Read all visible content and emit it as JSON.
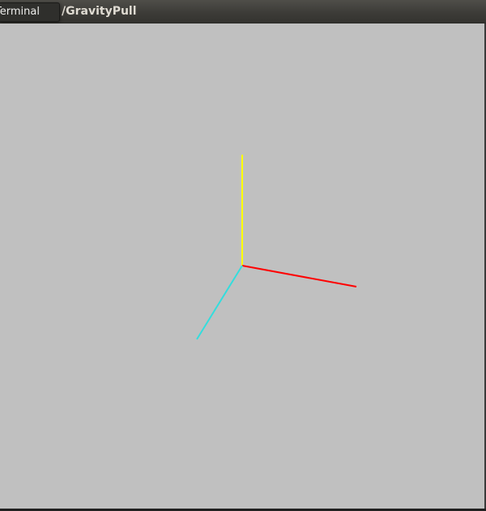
{
  "window": {
    "title": "/GravityPull"
  },
  "tooltip": {
    "label": "Terminal"
  },
  "axes": {
    "x_color": "#ff0000",
    "y_color": "#ffff00",
    "z_color": "#33dddd"
  },
  "colors": {
    "background": "#c0c0c0",
    "titlebar": "#3d3c38"
  }
}
